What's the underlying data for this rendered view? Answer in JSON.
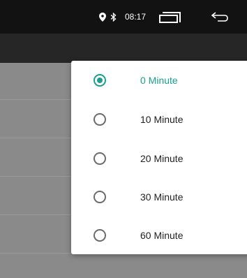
{
  "status_bar": {
    "time": "08:17",
    "icons": [
      "location-icon",
      "bluetooth-icon",
      "recent-apps-icon",
      "back-icon"
    ]
  },
  "dialog": {
    "options": [
      {
        "label": "0 Minute",
        "selected": true
      },
      {
        "label": "10 Minute",
        "selected": false
      },
      {
        "label": "20 Minute",
        "selected": false
      },
      {
        "label": "30 Minute",
        "selected": false
      },
      {
        "label": "60 Minute",
        "selected": false
      }
    ]
  },
  "colors": {
    "accent": "#1a9e8f",
    "status_bar": "#121212",
    "toolbar": "#262626"
  }
}
